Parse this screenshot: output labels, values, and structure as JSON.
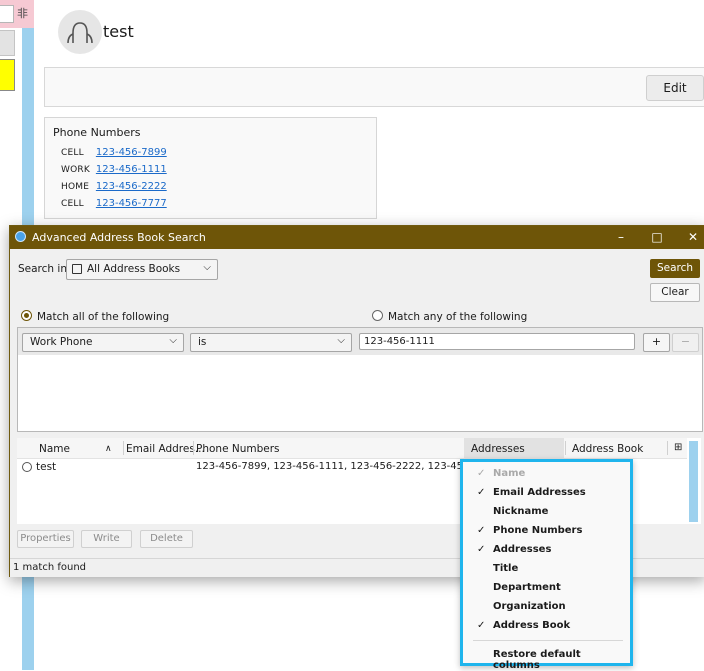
{
  "left_strip": {
    "glyph": "非"
  },
  "contact": {
    "name": "test",
    "edit_label": "Edit",
    "phone_section_title": "Phone Numbers",
    "phones": [
      {
        "type": "CELL",
        "number": "123-456-7899"
      },
      {
        "type": "WORK",
        "number": "123-456-1111"
      },
      {
        "type": "HOME",
        "number": "123-456-2222"
      },
      {
        "type": "CELL",
        "number": "123-456-7777"
      }
    ]
  },
  "dialog": {
    "title": "Advanced Address Book Search",
    "search_in_label": "Search in:",
    "address_book_value": "All Address Books",
    "search_label": "Search",
    "clear_label": "Clear",
    "match_all_label": "Match all of the following",
    "match_any_label": "Match any of the following",
    "criteria": {
      "field": "Work Phone",
      "operator": "is",
      "value": "123-456-1111",
      "add_label": "+",
      "remove_label": "−"
    },
    "columns": {
      "name": "Name",
      "email": "Email Addres...",
      "phone": "Phone Numbers",
      "addresses": "Addresses",
      "address_book": "Address Book"
    },
    "result": {
      "name": "test",
      "phones": "123-456-7899, 123-456-1111, 123-456-2222, 123-456-7777"
    },
    "buttons": {
      "properties": "Properties",
      "write": "Write",
      "delete": "Delete"
    },
    "status": "1 match found"
  },
  "column_menu": {
    "items": [
      {
        "label": "Name",
        "checked": true,
        "disabled": true
      },
      {
        "label": "Email Addresses",
        "checked": true,
        "disabled": false
      },
      {
        "label": "Nickname",
        "checked": false,
        "disabled": false
      },
      {
        "label": "Phone Numbers",
        "checked": true,
        "disabled": false
      },
      {
        "label": "Addresses",
        "checked": true,
        "disabled": false
      },
      {
        "label": "Title",
        "checked": false,
        "disabled": false
      },
      {
        "label": "Department",
        "checked": false,
        "disabled": false
      },
      {
        "label": "Organization",
        "checked": false,
        "disabled": false
      },
      {
        "label": "Address Book",
        "checked": true,
        "disabled": false
      }
    ],
    "restore_label": "Restore default columns"
  },
  "colors": {
    "accent": "#6e5508",
    "highlight_border": "#1fb5ed",
    "link": "#1b6ac9"
  }
}
